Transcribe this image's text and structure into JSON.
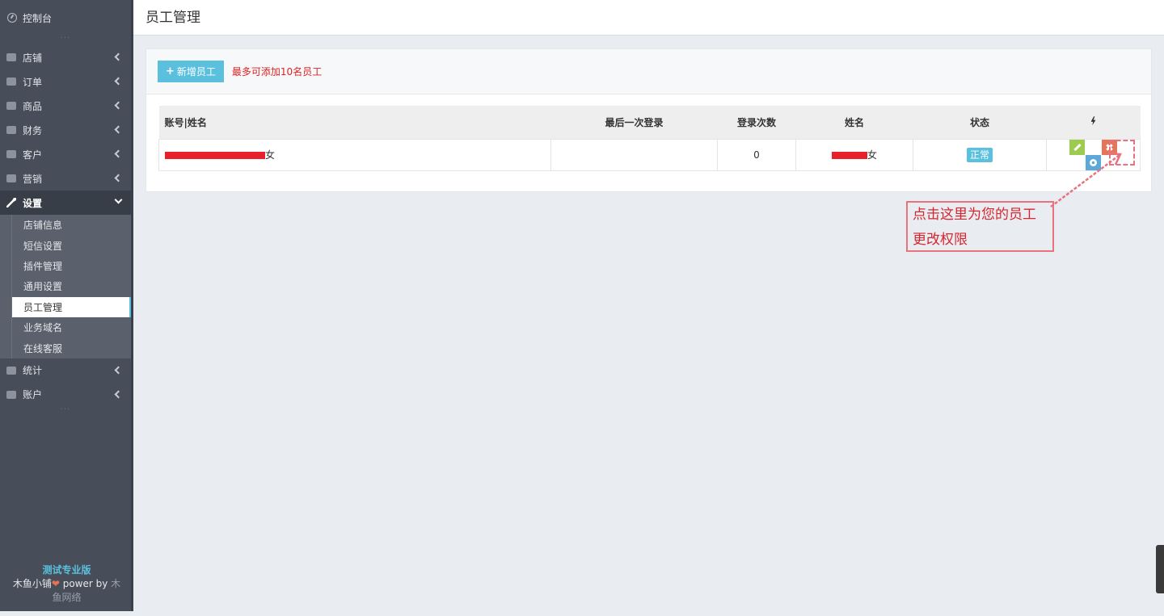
{
  "sidebar": {
    "dashboard": "控制台",
    "items": [
      {
        "label": "店铺"
      },
      {
        "label": "订单"
      },
      {
        "label": "商品"
      },
      {
        "label": "财务"
      },
      {
        "label": "客户"
      },
      {
        "label": "营销"
      }
    ],
    "settings": {
      "label": "设置",
      "sub": [
        "店铺信息",
        "短信设置",
        "插件管理",
        "通用设置",
        "员工管理",
        "业务域名",
        "在线客服"
      ]
    },
    "bottom_items": [
      {
        "label": "统计"
      },
      {
        "label": "账户"
      }
    ],
    "footer": {
      "version": "测试专业版",
      "brand": "木鱼小铺",
      "power": " power by ",
      "org_a": "木",
      "org_b": "鱼网络"
    }
  },
  "header": {
    "title": "员工管理"
  },
  "panel": {
    "add_button": "新增员工",
    "hint": "最多可添加10名员工"
  },
  "table": {
    "columns": [
      "账号|姓名",
      "最后一次登录",
      "登录次数",
      "姓名",
      "状态"
    ],
    "rows": [
      {
        "account_suffix": "女",
        "last_login": "",
        "login_count": "0",
        "name_suffix": "女",
        "status": "正常"
      }
    ]
  },
  "annotation": {
    "line1": "点击这里为您的员工",
    "line2": "更改权限"
  },
  "colors": {
    "accent": "#5bc0de",
    "hint_red": "#dd2222",
    "sidebar_bg": "#474e5a"
  }
}
